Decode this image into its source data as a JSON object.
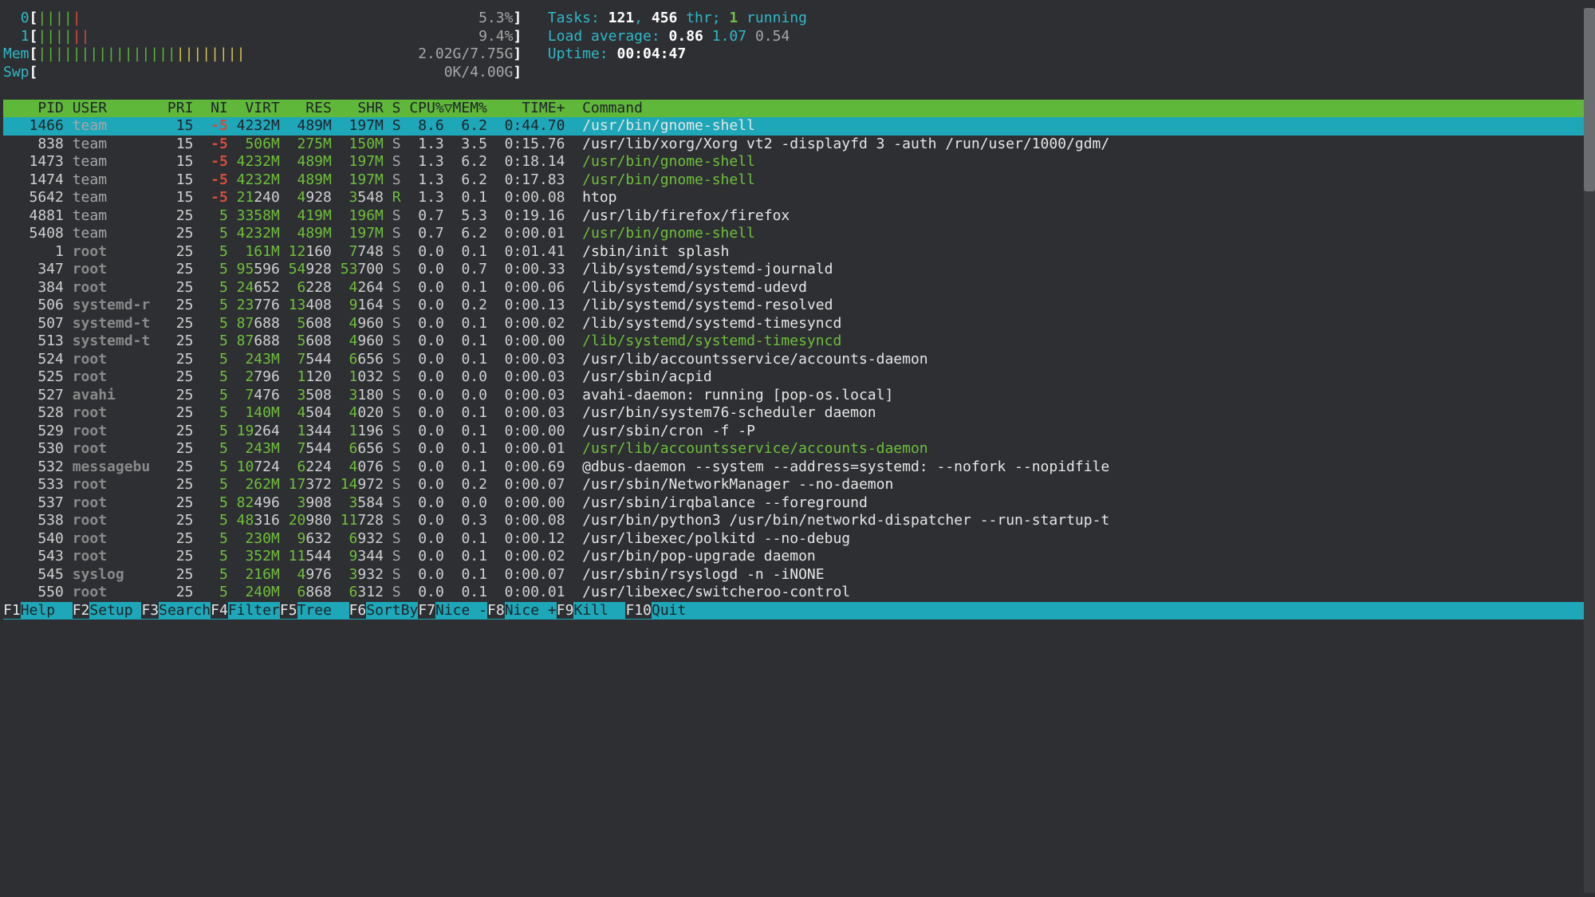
{
  "meters": {
    "cpu0": {
      "label": "0",
      "pct": "5.3%",
      "bars": {
        "green": 4,
        "red": 1
      }
    },
    "cpu1": {
      "label": "1",
      "pct": "9.4%",
      "bars": {
        "green": 4,
        "red": 2
      }
    },
    "mem": {
      "label": "Mem",
      "txt": "2.02G/7.75G",
      "bars": {
        "green": 16,
        "yellow": 8
      }
    },
    "swp": {
      "label": "Swp",
      "txt": "0K/4.00G"
    }
  },
  "summary": {
    "tasks_label": "Tasks: ",
    "tasks_procs": "121",
    "tasks_sep": ", ",
    "tasks_thr": "456",
    "tasks_tail": " thr; ",
    "tasks_running_n": "1",
    "tasks_running_t": " running",
    "load_label": "Load average: ",
    "load1": "0.86",
    "load5": "1.07",
    "load15": "0.54",
    "uptime_label": "Uptime: ",
    "uptime": "00:04:47"
  },
  "columns": [
    "PID",
    "USER",
    "PRI",
    "NI",
    "VIRT",
    "RES",
    "SHR",
    "S",
    "CPU%",
    "MEM%",
    "TIME+",
    "Command"
  ],
  "sort_col": "CPU%",
  "selected_pid": 1466,
  "rows": [
    {
      "pid": "1466",
      "user": "team",
      "usercls": "grey",
      "pri": "15",
      "ni": "-5",
      "nicls": "red",
      "virt": "4232M",
      "res": "489M",
      "shr": "197M",
      "s": "S",
      "cpu": "8.6",
      "mem": "6.2",
      "time": "0:44.70",
      "cmd": "/usr/bin/gnome-shell",
      "cmdcls": "white"
    },
    {
      "pid": "838",
      "user": "team",
      "usercls": "grey",
      "pri": "15",
      "ni": "-5",
      "nicls": "red",
      "virt": "506M",
      "res": "275M",
      "shr": "150M",
      "s": "S",
      "cpu": "1.3",
      "mem": "3.5",
      "time": "0:15.76",
      "cmd": "/usr/lib/xorg/Xorg vt2 -displayfd 3 -auth /run/user/1000/gdm/",
      "cmdcls": "white"
    },
    {
      "pid": "1473",
      "user": "team",
      "usercls": "grey",
      "pri": "15",
      "ni": "-5",
      "nicls": "red",
      "virt": "4232M",
      "res": "489M",
      "shr": "197M",
      "s": "S",
      "cpu": "1.3",
      "mem": "6.2",
      "time": "0:18.14",
      "cmd": "/usr/bin/gnome-shell",
      "cmdcls": "green"
    },
    {
      "pid": "1474",
      "user": "team",
      "usercls": "grey",
      "pri": "15",
      "ni": "-5",
      "nicls": "red",
      "virt": "4232M",
      "res": "489M",
      "shr": "197M",
      "s": "S",
      "cpu": "1.3",
      "mem": "6.2",
      "time": "0:17.83",
      "cmd": "/usr/bin/gnome-shell",
      "cmdcls": "green"
    },
    {
      "pid": "5642",
      "user": "team",
      "usercls": "grey",
      "pri": "15",
      "ni": "-5",
      "nicls": "red",
      "virt": "21240",
      "res": "4928",
      "shr": "3548",
      "s": "R",
      "scolor": "green",
      "cpu": "1.3",
      "mem": "0.1",
      "time": "0:00.08",
      "cmd": "htop",
      "cmdcls": "white"
    },
    {
      "pid": "4881",
      "user": "team",
      "usercls": "grey",
      "pri": "25",
      "ni": "5",
      "nicls": "green",
      "virt": "3358M",
      "res": "419M",
      "shr": "196M",
      "s": "S",
      "cpu": "0.7",
      "mem": "5.3",
      "time": "0:19.16",
      "cmd": "/usr/lib/firefox/firefox",
      "cmdcls": "white"
    },
    {
      "pid": "5408",
      "user": "team",
      "usercls": "grey",
      "pri": "25",
      "ni": "5",
      "nicls": "green",
      "virt": "4232M",
      "res": "489M",
      "shr": "197M",
      "s": "S",
      "cpu": "0.7",
      "mem": "6.2",
      "time": "0:00.01",
      "cmd": "/usr/bin/gnome-shell",
      "cmdcls": "green"
    },
    {
      "pid": "1",
      "user": "root",
      "usercls": "dim",
      "pri": "25",
      "ni": "5",
      "nicls": "green",
      "virt": "161M",
      "res": "12160",
      "shr": "7748",
      "s": "S",
      "cpu": "0.0",
      "mem": "0.1",
      "time": "0:01.41",
      "cmd": "/sbin/init splash",
      "cmdcls": "white"
    },
    {
      "pid": "347",
      "user": "root",
      "usercls": "dim",
      "pri": "25",
      "ni": "5",
      "nicls": "green",
      "virt": "95596",
      "res": "54928",
      "shr": "53700",
      "s": "S",
      "cpu": "0.0",
      "mem": "0.7",
      "time": "0:00.33",
      "cmd": "/lib/systemd/systemd-journald",
      "cmdcls": "white"
    },
    {
      "pid": "384",
      "user": "root",
      "usercls": "dim",
      "pri": "25",
      "ni": "5",
      "nicls": "green",
      "virt": "24652",
      "res": "6228",
      "shr": "4264",
      "s": "S",
      "cpu": "0.0",
      "mem": "0.1",
      "time": "0:00.06",
      "cmd": "/lib/systemd/systemd-udevd",
      "cmdcls": "white"
    },
    {
      "pid": "506",
      "user": "systemd-r",
      "usercls": "dim",
      "pri": "25",
      "ni": "5",
      "nicls": "green",
      "virt": "23776",
      "res": "13408",
      "shr": "9164",
      "s": "S",
      "cpu": "0.0",
      "mem": "0.2",
      "time": "0:00.13",
      "cmd": "/lib/systemd/systemd-resolved",
      "cmdcls": "white"
    },
    {
      "pid": "507",
      "user": "systemd-t",
      "usercls": "dim",
      "pri": "25",
      "ni": "5",
      "nicls": "green",
      "virt": "87688",
      "res": "5608",
      "shr": "4960",
      "s": "S",
      "cpu": "0.0",
      "mem": "0.1",
      "time": "0:00.02",
      "cmd": "/lib/systemd/systemd-timesyncd",
      "cmdcls": "white"
    },
    {
      "pid": "513",
      "user": "systemd-t",
      "usercls": "dim",
      "pri": "25",
      "ni": "5",
      "nicls": "green",
      "virt": "87688",
      "res": "5608",
      "shr": "4960",
      "s": "S",
      "cpu": "0.0",
      "mem": "0.1",
      "time": "0:00.00",
      "cmd": "/lib/systemd/systemd-timesyncd",
      "cmdcls": "green"
    },
    {
      "pid": "524",
      "user": "root",
      "usercls": "dim",
      "pri": "25",
      "ni": "5",
      "nicls": "green",
      "virt": "243M",
      "res": "7544",
      "shr": "6656",
      "s": "S",
      "cpu": "0.0",
      "mem": "0.1",
      "time": "0:00.03",
      "cmd": "/usr/lib/accountsservice/accounts-daemon",
      "cmdcls": "white"
    },
    {
      "pid": "525",
      "user": "root",
      "usercls": "dim",
      "pri": "25",
      "ni": "5",
      "nicls": "green",
      "virt": "2796",
      "res": "1120",
      "shr": "1032",
      "s": "S",
      "cpu": "0.0",
      "mem": "0.0",
      "time": "0:00.03",
      "cmd": "/usr/sbin/acpid",
      "cmdcls": "white"
    },
    {
      "pid": "527",
      "user": "avahi",
      "usercls": "dim",
      "pri": "25",
      "ni": "5",
      "nicls": "green",
      "virt": "7476",
      "res": "3508",
      "shr": "3180",
      "s": "S",
      "cpu": "0.0",
      "mem": "0.0",
      "time": "0:00.03",
      "cmd": "avahi-daemon: running [pop-os.local]",
      "cmdcls": "white"
    },
    {
      "pid": "528",
      "user": "root",
      "usercls": "dim",
      "pri": "25",
      "ni": "5",
      "nicls": "green",
      "virt": "140M",
      "res": "4504",
      "shr": "4020",
      "s": "S",
      "cpu": "0.0",
      "mem": "0.1",
      "time": "0:00.03",
      "cmd": "/usr/bin/system76-scheduler daemon",
      "cmdcls": "white"
    },
    {
      "pid": "529",
      "user": "root",
      "usercls": "dim",
      "pri": "25",
      "ni": "5",
      "nicls": "green",
      "virt": "19264",
      "res": "1344",
      "shr": "1196",
      "s": "S",
      "cpu": "0.0",
      "mem": "0.1",
      "time": "0:00.00",
      "cmd": "/usr/sbin/cron -f -P",
      "cmdcls": "white"
    },
    {
      "pid": "530",
      "user": "root",
      "usercls": "dim",
      "pri": "25",
      "ni": "5",
      "nicls": "green",
      "virt": "243M",
      "res": "7544",
      "shr": "6656",
      "s": "S",
      "cpu": "0.0",
      "mem": "0.1",
      "time": "0:00.01",
      "cmd": "/usr/lib/accountsservice/accounts-daemon",
      "cmdcls": "green"
    },
    {
      "pid": "532",
      "user": "messagebu",
      "usercls": "dim",
      "pri": "25",
      "ni": "5",
      "nicls": "green",
      "virt": "10724",
      "res": "6224",
      "shr": "4076",
      "s": "S",
      "cpu": "0.0",
      "mem": "0.1",
      "time": "0:00.69",
      "cmd": "@dbus-daemon --system --address=systemd: --nofork --nopidfile",
      "cmdcls": "white"
    },
    {
      "pid": "533",
      "user": "root",
      "usercls": "dim",
      "pri": "25",
      "ni": "5",
      "nicls": "green",
      "virt": "262M",
      "res": "17372",
      "shr": "14972",
      "s": "S",
      "cpu": "0.0",
      "mem": "0.2",
      "time": "0:00.07",
      "cmd": "/usr/sbin/NetworkManager --no-daemon",
      "cmdcls": "white"
    },
    {
      "pid": "537",
      "user": "root",
      "usercls": "dim",
      "pri": "25",
      "ni": "5",
      "nicls": "green",
      "virt": "82496",
      "res": "3908",
      "shr": "3584",
      "s": "S",
      "cpu": "0.0",
      "mem": "0.0",
      "time": "0:00.00",
      "cmd": "/usr/sbin/irqbalance --foreground",
      "cmdcls": "white"
    },
    {
      "pid": "538",
      "user": "root",
      "usercls": "dim",
      "pri": "25",
      "ni": "5",
      "nicls": "green",
      "virt": "48316",
      "res": "20980",
      "shr": "11728",
      "s": "S",
      "cpu": "0.0",
      "mem": "0.3",
      "time": "0:00.08",
      "cmd": "/usr/bin/python3 /usr/bin/networkd-dispatcher --run-startup-t",
      "cmdcls": "white"
    },
    {
      "pid": "540",
      "user": "root",
      "usercls": "dim",
      "pri": "25",
      "ni": "5",
      "nicls": "green",
      "virt": "230M",
      "res": "9632",
      "shr": "6932",
      "s": "S",
      "cpu": "0.0",
      "mem": "0.1",
      "time": "0:00.12",
      "cmd": "/usr/libexec/polkitd --no-debug",
      "cmdcls": "white"
    },
    {
      "pid": "543",
      "user": "root",
      "usercls": "dim",
      "pri": "25",
      "ni": "5",
      "nicls": "green",
      "virt": "352M",
      "res": "11544",
      "shr": "9344",
      "s": "S",
      "cpu": "0.0",
      "mem": "0.1",
      "time": "0:00.02",
      "cmd": "/usr/bin/pop-upgrade daemon",
      "cmdcls": "white"
    },
    {
      "pid": "545",
      "user": "syslog",
      "usercls": "dim",
      "pri": "25",
      "ni": "5",
      "nicls": "green",
      "virt": "216M",
      "res": "4976",
      "shr": "3932",
      "s": "S",
      "cpu": "0.0",
      "mem": "0.1",
      "time": "0:00.07",
      "cmd": "/usr/sbin/rsyslogd -n -iNONE",
      "cmdcls": "white"
    },
    {
      "pid": "550",
      "user": "root",
      "usercls": "dim",
      "pri": "25",
      "ni": "5",
      "nicls": "green",
      "virt": "240M",
      "res": "6868",
      "shr": "6312",
      "s": "S",
      "cpu": "0.0",
      "mem": "0.1",
      "time": "0:00.01",
      "cmd": "/usr/libexec/switcheroo-control",
      "cmdcls": "white"
    }
  ],
  "fkeys": [
    {
      "k": "F1",
      "n": "Help  "
    },
    {
      "k": "F2",
      "n": "Setup "
    },
    {
      "k": "F3",
      "n": "Search"
    },
    {
      "k": "F4",
      "n": "Filter"
    },
    {
      "k": "F5",
      "n": "Tree  "
    },
    {
      "k": "F6",
      "n": "SortBy"
    },
    {
      "k": "F7",
      "n": "Nice -"
    },
    {
      "k": "F8",
      "n": "Nice +"
    },
    {
      "k": "F9",
      "n": "Kill  "
    },
    {
      "k": "F10",
      "n": "Quit  "
    }
  ]
}
